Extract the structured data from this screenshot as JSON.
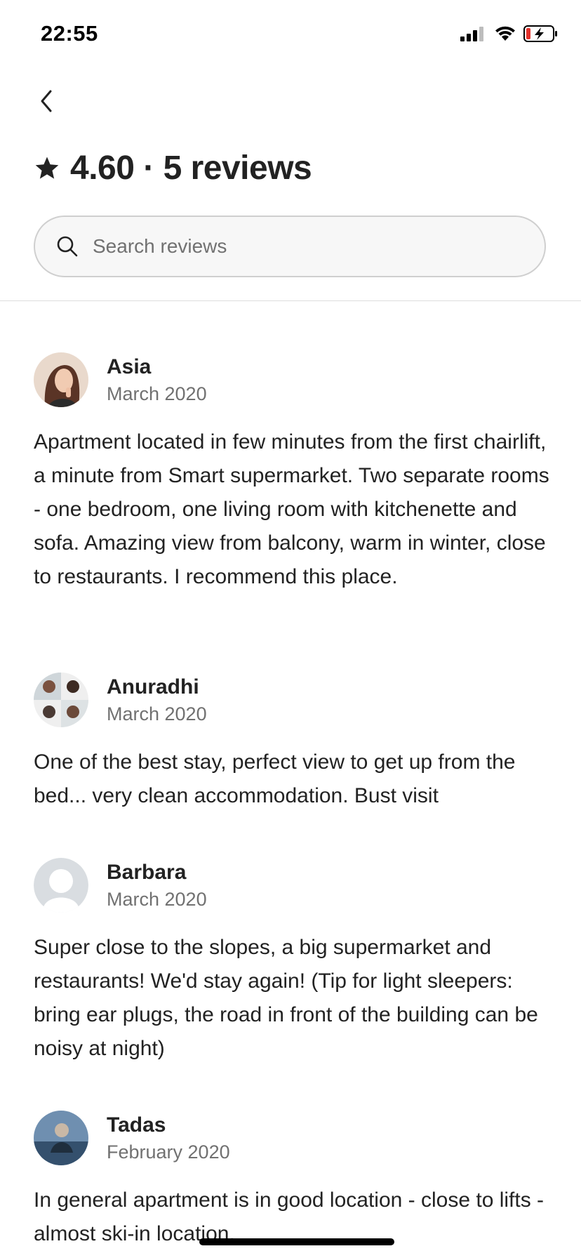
{
  "status_bar": {
    "time": "22:55"
  },
  "header": {
    "rating_line": "4.60 · 5 reviews"
  },
  "search": {
    "placeholder": "Search reviews",
    "value": ""
  },
  "reviews": [
    {
      "name": "Asia",
      "date": "March 2020",
      "text": "Apartment located in few minutes from the first chairlift, a minute from Smart supermarket. Two separate rooms - one bedroom, one living room with kitchenette and sofa. Amazing view from balcony, warm in winter, close to restaurants. I recommend this place."
    },
    {
      "name": "Anuradhi",
      "date": "March 2020",
      "text": "One of the best stay, perfect view to get up from the bed... very clean accommodation. Bust visit"
    },
    {
      "name": "Barbara",
      "date": "March 2020",
      "text": "Super close to the slopes, a big supermarket and restaurants! We'd stay again! (Tip for light sleepers: bring ear plugs, the road in front of the building can be noisy at night)"
    },
    {
      "name": "Tadas",
      "date": "February 2020",
      "text": "In general apartment is in good location - close to lifts - almost ski-in location."
    }
  ],
  "icons": {
    "back": "chevron-left-icon",
    "star": "star-icon",
    "search": "search-icon",
    "signal": "cellular-signal-icon",
    "wifi": "wifi-icon",
    "battery": "battery-charging-icon"
  },
  "colors": {
    "text": "#222222",
    "secondary": "#717171",
    "battery_low": "#e3312b"
  }
}
